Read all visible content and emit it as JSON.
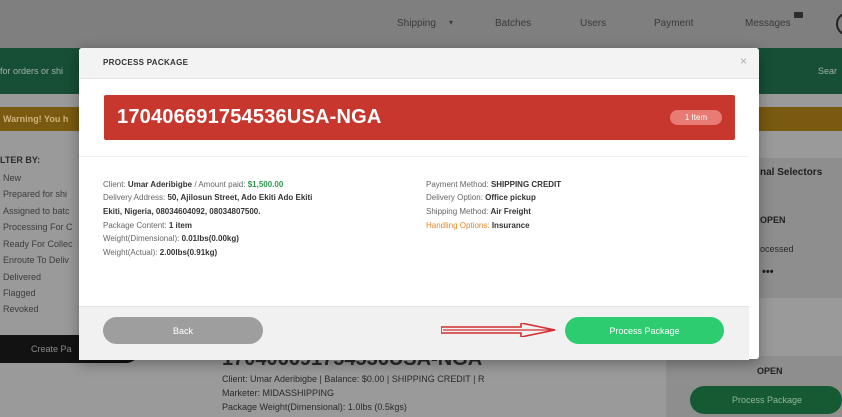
{
  "nav": {
    "items": [
      "Shipping",
      "Batches",
      "Users",
      "Payment",
      "Messages"
    ]
  },
  "search": {
    "placeholder_visible": "for orders or shi",
    "right_text": "Sear"
  },
  "warning": {
    "text": "Warning! You h"
  },
  "filter": {
    "title": "LTER BY:",
    "items": [
      "New",
      "Prepared for shi",
      "Assigned to batc",
      "Processing For C",
      "Ready For Collec",
      "Enroute To Deliv",
      "Delivered",
      "Flagged",
      "Revoked"
    ]
  },
  "create_button": "Create Pa",
  "right_panel": {
    "title": "nal Selectors",
    "open": "OPEN",
    "processed": "ocessed",
    "dots": "•••",
    "open2": "OPEN",
    "button": "Process Package"
  },
  "background_card": {
    "tracking": "170406691754536USA-NGA",
    "client_line": "Client:  Umar Aderibigbe |  Balance: $0.00  | SHIPPING CREDIT  | R",
    "marketer_line": "Marketer:  MIDASSHIPPING",
    "weight_line": "Package Weight(Dimensional):  1.0lbs (0.5kgs)"
  },
  "modal": {
    "title": "PROCESS PACKAGE",
    "close": "×",
    "tracking": "170406691754536USA-NGA",
    "item_badge": "1 Item",
    "left": {
      "client_label": "Client:",
      "client_name": "Umar Aderibigbe",
      "amount_label": " / Amount paid:",
      "amount": "$1,500.00",
      "address_label": "Delivery Address:",
      "address_line1": "50, Ajilosun Street, Ado Ekiti Ado Ekiti",
      "address_line2": "Ekiti, Nigeria, 08034604092, 08034807500.",
      "content_label": "Package Content:",
      "content": "1 item",
      "dim_label": "Weight(Dimensional):",
      "dim": "0.01lbs(0.00kg)",
      "actual_label": "Weight(Actual):",
      "actual": "2.00lbs(0.91kg)"
    },
    "right": {
      "payment_label": "Payment Method:",
      "payment": "SHIPPING CREDIT",
      "delivery_label": "Delivery Option:",
      "delivery": "Office pickup",
      "shipping_label": "Shipping Method:",
      "shipping": "Air Freight",
      "handling_label": "Handling Options:",
      "handling": "Insurance"
    },
    "back_button": "Back",
    "process_button": "Process Package"
  },
  "colors": {
    "banner": "#c8372d",
    "process_button": "#2ecc71",
    "amount_green": "#2c9a4d",
    "handling_orange": "#e3862b",
    "arrow_red": "#d32f2f"
  }
}
